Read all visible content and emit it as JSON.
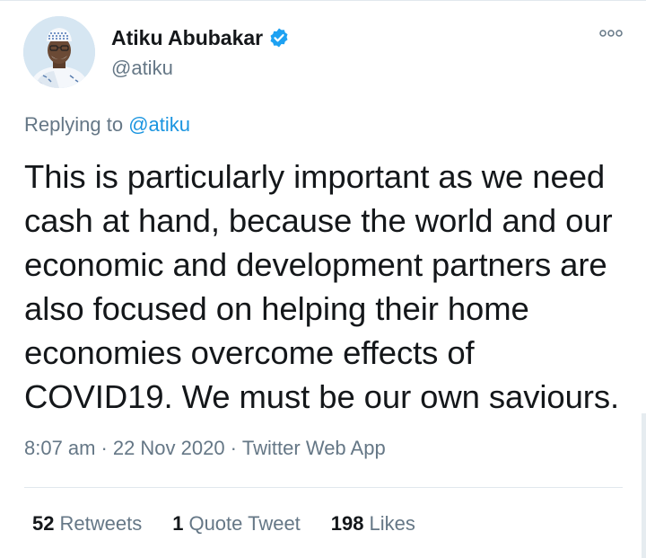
{
  "author": {
    "name": "Atiku Abubakar",
    "handle": "@atiku",
    "verified": true
  },
  "reply": {
    "prefix": "Replying to ",
    "mention": "@atiku"
  },
  "tweet": {
    "text": "This is particularly important as we need\ncash at hand, because the world and our\neconomic and development partners are\nalso focused on helping their home\neconomies overcome effects of\nCOVID19. We must be our own saviours."
  },
  "meta": {
    "time": "8:07 am",
    "separator": "·",
    "date": "22 Nov 2020",
    "source": "Twitter Web App"
  },
  "stats": {
    "retweets_count": "52",
    "retweets_label": "Retweets",
    "quotes_count": "1",
    "quotes_label": "Quote Tweet",
    "likes_count": "198",
    "likes_label": "Likes"
  },
  "icons": {
    "more": "more-options-icon",
    "verified": "verified-badge-icon"
  },
  "colors": {
    "accent": "#1da1f2",
    "mention": "#1b95e0",
    "muted": "#657786",
    "text": "#14171a",
    "divider": "#e1e8ed"
  }
}
